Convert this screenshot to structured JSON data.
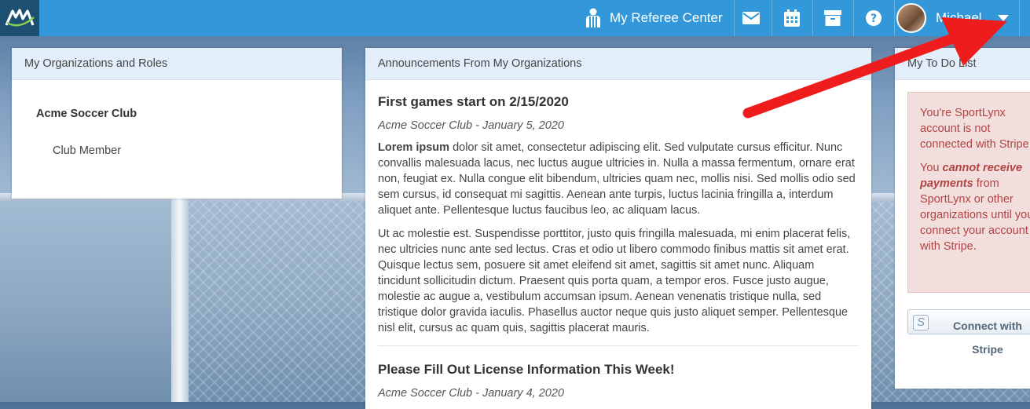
{
  "header": {
    "referee_center": "My Referee Center",
    "user_name": "Michael"
  },
  "organizations": {
    "title": "My Organizations and Roles",
    "org_name": "Acme Soccer Club",
    "role": "Club Member"
  },
  "announcements": {
    "title": "Announcements From My Organizations",
    "items": [
      {
        "title": "First games start on 2/15/2020",
        "meta": "Acme Soccer Club - January 5, 2020",
        "p1_bold": "Lorem ipsum",
        "p1_rest": " dolor sit amet, consectetur adipiscing elit. Sed vulputate cursus efficitur. Nunc convallis malesuada lacus, nec luctus augue ultricies in. Nulla a massa fermentum, ornare erat non, feugiat ex. Nulla congue elit bibendum, ultricies quam nec, mollis nisi. Sed mollis odio sed sem cursus, id consequat mi sagittis. Aenean ante turpis, luctus lacinia fringilla a, interdum aliquet ante. Pellentesque luctus faucibus leo, ac aliquam lacus.",
        "p2": "Ut ac molestie est. Suspendisse porttitor, justo quis fringilla malesuada, mi enim placerat felis, nec ultricies nunc ante sed lectus. Cras et odio ut libero commodo finibus mattis sit amet erat. Quisque lectus sem, posuere sit amet eleifend sit amet, sagittis sit amet nunc. Aliquam tincidunt sollicitudin dictum. Praesent quis porta quam, a tempor eros. Fusce justo augue, molestie ac augue a, vestibulum accumsan ipsum. Aenean venenatis tristique nulla, sed tristique dolor gravida iaculis. Phasellus auctor neque quis justo aliquet semper. Pellentesque nisl elit, cursus ac quam quis, sagittis placerat mauris."
      },
      {
        "title": "Please Fill Out License Information This Week!",
        "meta": "Acme Soccer Club - January 4, 2020"
      }
    ]
  },
  "todo": {
    "title": "My To Do List",
    "alert_line1": "You're SportLynx account is not connected with Stripe.",
    "alert_you": "You ",
    "alert_emph": "cannot receive payments",
    "alert_rest": " from SportLynx or other organizations until you connect your account with Stripe.",
    "stripe_button": "Connect with Stripe",
    "stripe_icon": "S"
  },
  "colors": {
    "topbar": "#3398d9",
    "logo_bg": "#1c4f72",
    "panel_header": "#e2eef9",
    "alert_text": "#b04443",
    "alert_bg": "#f3dede",
    "annotation_arrow": "#ee1c1c"
  },
  "icons": [
    "referee-icon",
    "envelope-icon",
    "calendar-icon",
    "archive-icon",
    "help-icon",
    "caret-down-icon"
  ]
}
